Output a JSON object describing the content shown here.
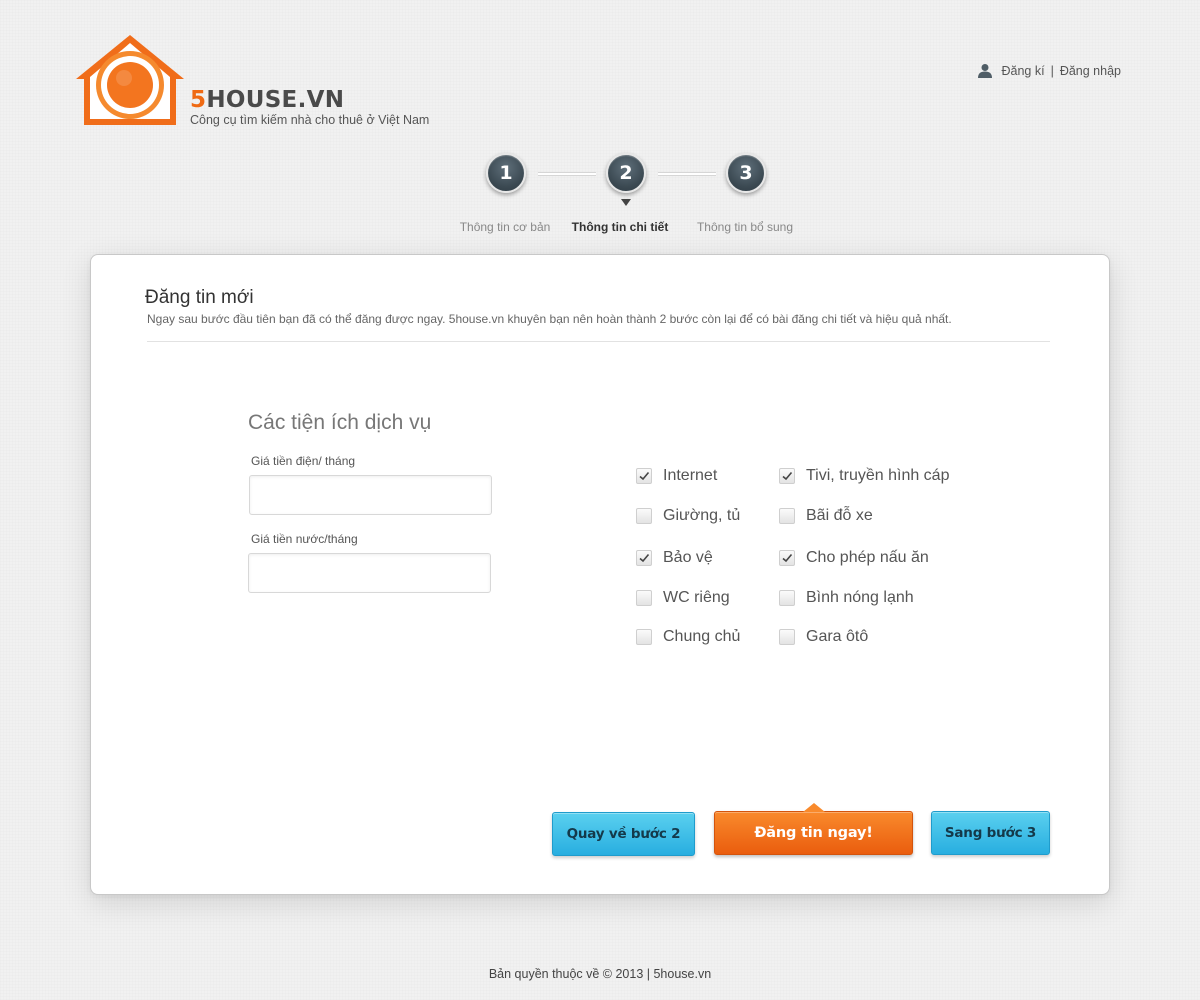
{
  "header": {
    "brand_number": "5",
    "brand_rest": "HOUSE.VN",
    "tagline": "Công cụ tìm kiếm nhà cho thuê ở Việt Nam",
    "auth": {
      "register": "Đăng kí",
      "separator": "|",
      "login": "Đăng nhập"
    }
  },
  "steps": {
    "items": [
      {
        "number": "1",
        "label": "Thông tin cơ bản"
      },
      {
        "number": "2",
        "label": "Thông tin chi tiết"
      },
      {
        "number": "3",
        "label": "Thông tin bổ sung"
      }
    ],
    "active_step": "2"
  },
  "card": {
    "title": "Đăng tin mới",
    "description": "Ngay sau bước đầu tiên bạn đã có thể đăng được ngay. 5house.vn khuyên bạn nên hoàn thành 2 bước còn lại để có bài đăng chi tiết và hiệu quả nhất.",
    "section_title": "Các tiện ích dịch vụ",
    "electric_label": "Giá tiền điện/ tháng",
    "electric_value": "",
    "water_label": "Giá tiền nước/tháng",
    "water_value": ""
  },
  "amenities": [
    {
      "label": "Internet",
      "checked": true
    },
    {
      "label": "Tivi, truyền hình cáp",
      "checked": true
    },
    {
      "label": "Giường, tủ",
      "checked": false
    },
    {
      "label": "Bãi đỗ xe",
      "checked": false
    },
    {
      "label": "Bảo vệ",
      "checked": true
    },
    {
      "label": "Cho phép nấu ăn",
      "checked": true
    },
    {
      "label": "WC riêng",
      "checked": false
    },
    {
      "label": "Bình nóng lạnh",
      "checked": false
    },
    {
      "label": "Chung chủ",
      "checked": false
    },
    {
      "label": "Gara ôtô",
      "checked": false
    }
  ],
  "buttons": {
    "back": "Quay về bước 2",
    "post": "Đăng tin ngay!",
    "next": "Sang bước 3"
  },
  "footer": {
    "copyright": "Bản quyền thuộc về © 2013 | 5house.vn"
  },
  "colors": {
    "brand_orange": "#ef6a14",
    "button_blue": "#28aee0",
    "button_orange": "#ea5d0e",
    "step_circle": "#3b4952"
  },
  "icons": {
    "logo": "house-logo-icon",
    "user": "user-icon",
    "checkbox_check": "check-icon",
    "step_pointer": "triangle-down-icon"
  }
}
